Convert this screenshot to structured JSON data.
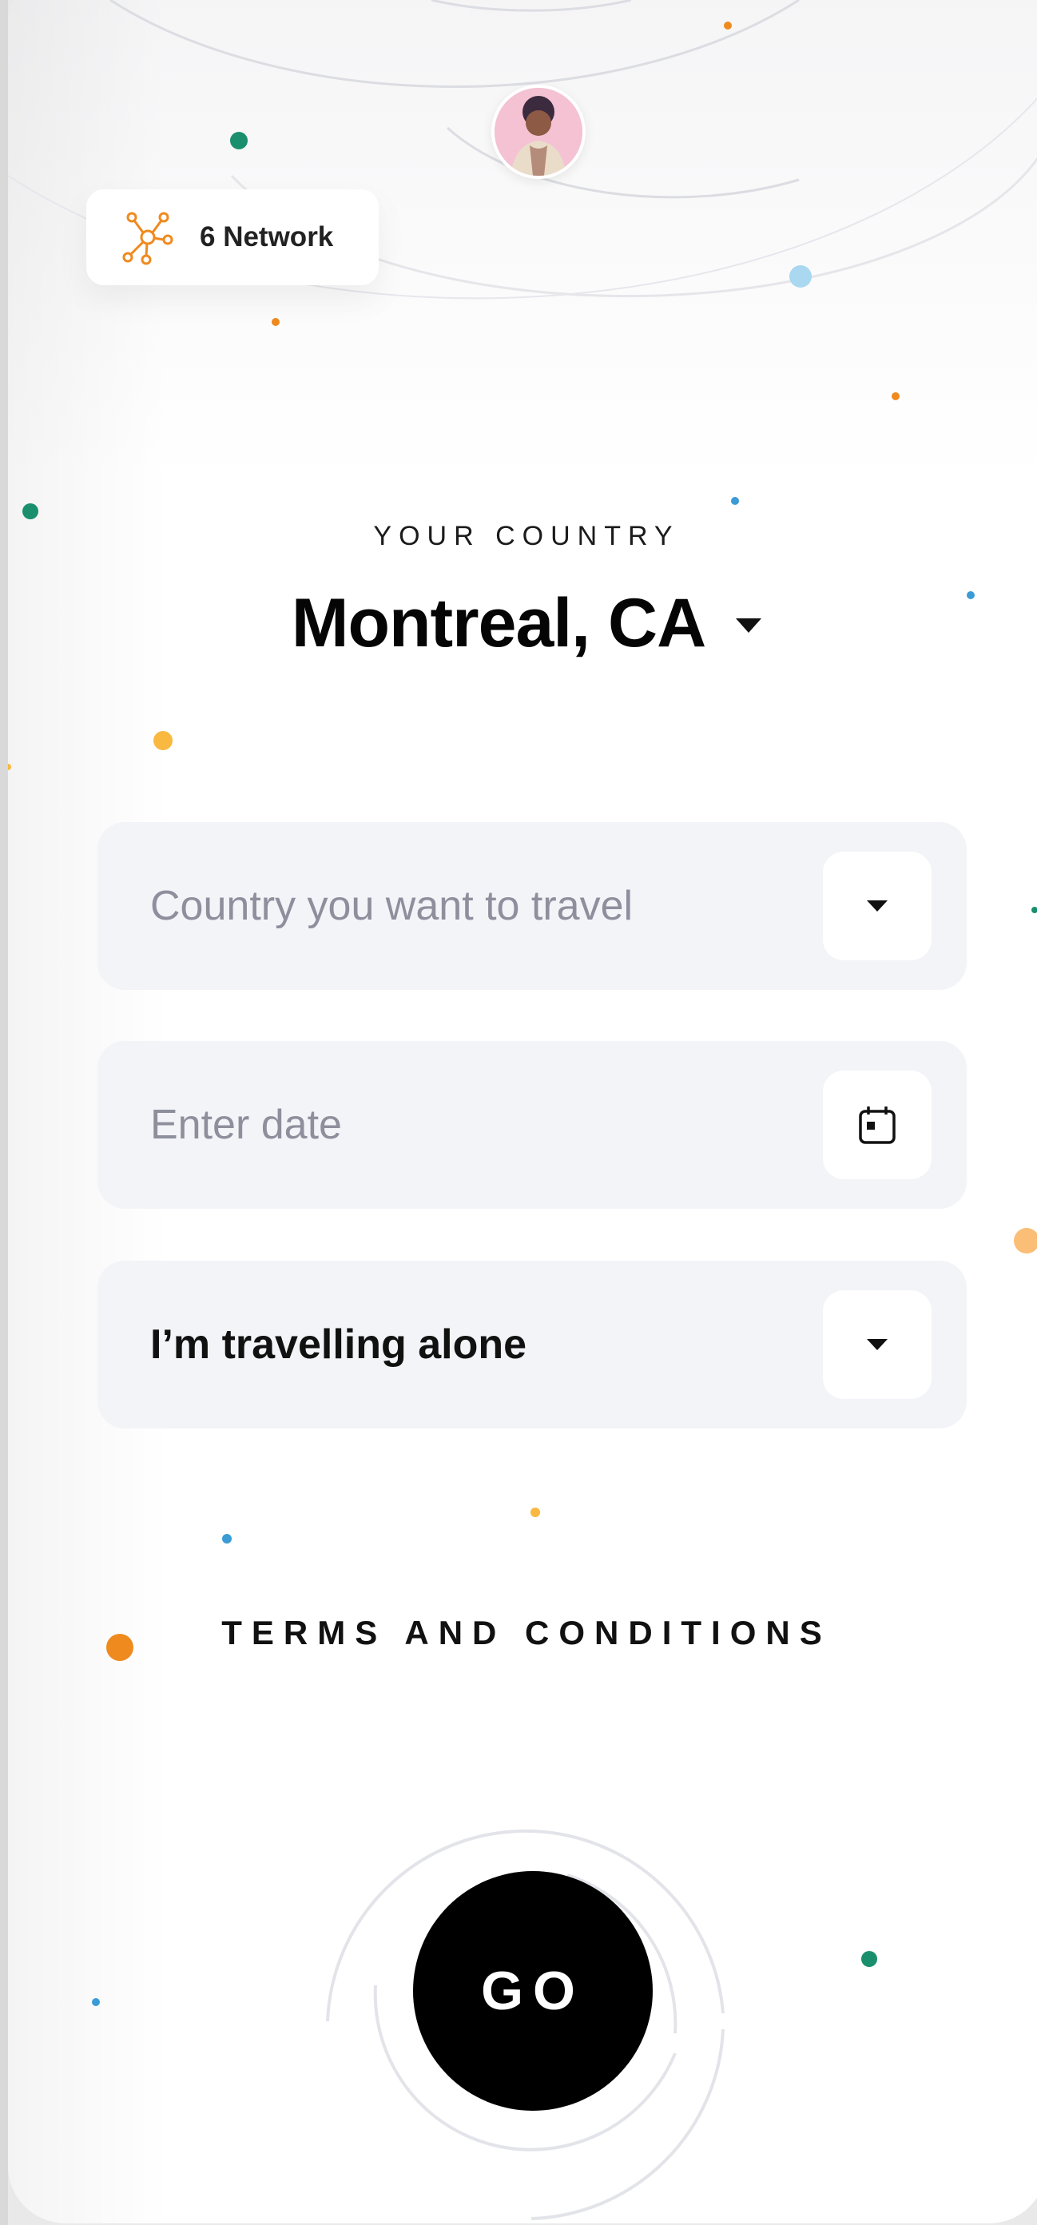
{
  "network": {
    "count_label": "6 Network",
    "icon": "network-icon"
  },
  "avatar": {
    "icon": "user-avatar"
  },
  "origin": {
    "section_label": "YOUR COUNTRY",
    "city": "Montreal, CA",
    "dropdown_icon": "caret-down-icon"
  },
  "form": {
    "destination": {
      "placeholder": "Country you want to travel",
      "icon": "caret-down-icon"
    },
    "date": {
      "placeholder": "Enter date",
      "icon": "calendar-icon"
    },
    "travellers": {
      "value": "I’m travelling alone",
      "icon": "caret-down-icon"
    }
  },
  "terms": {
    "label": "TERMS AND CONDITIONS"
  },
  "go_button": {
    "label": "GO"
  },
  "colors": {
    "accent_orange": "#ef8a1f",
    "accent_green": "#1a8f6e",
    "accent_blue": "#3a9bd5",
    "field_bg": "#f3f4f8",
    "button_bg": "#000000"
  }
}
